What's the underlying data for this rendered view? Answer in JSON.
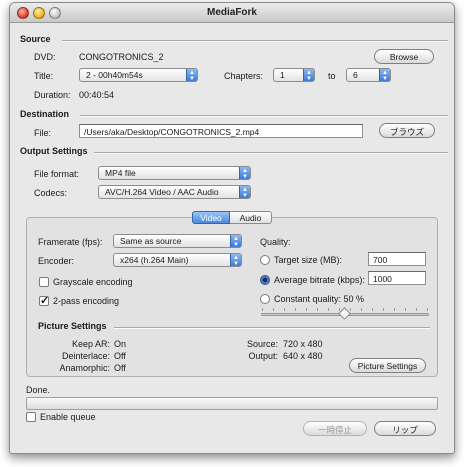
{
  "window": {
    "title": "MediaFork"
  },
  "source": {
    "section_label": "Source",
    "dvd_label": "DVD:",
    "dvd_value": "CONGOTRONICS_2",
    "browse_label": "Browse",
    "title_label": "Title:",
    "title_value": "2 - 00h40m54s",
    "chapters_label": "Chapters:",
    "chapter_from": "1",
    "to_label": "to",
    "chapter_to": "6",
    "duration_label": "Duration:",
    "duration_value": "00:40:54"
  },
  "destination": {
    "section_label": "Destination",
    "file_label": "File:",
    "file_value": "/Users/aka/Desktop/CONGOTRONICS_2.mp4",
    "browse_label": "ブラウズ"
  },
  "output": {
    "section_label": "Output Settings",
    "format_label": "File format:",
    "format_value": "MP4 file",
    "codecs_label": "Codecs:",
    "codecs_value": "AVC/H.264 Video / AAC Audio"
  },
  "tabs": {
    "video": "Video",
    "audio": "Audio",
    "selected": "Video"
  },
  "video": {
    "framerate_label": "Framerate (fps):",
    "framerate_value": "Same as source",
    "encoder_label": "Encoder:",
    "encoder_value": "x264 (h.264 Main)",
    "grayscale_label": "Grayscale encoding",
    "grayscale_checked": false,
    "twopass_label": "2-pass encoding",
    "twopass_checked": true,
    "quality_label": "Quality:",
    "target_size_label": "Target size (MB):",
    "target_size_value": "700",
    "avg_bitrate_label": "Average bitrate (kbps):",
    "avg_bitrate_value": "1000",
    "constant_quality_label": "Constant quality: 50 %",
    "quality_selected": "Average bitrate",
    "quality_slider_fraction": 0.5
  },
  "picture": {
    "section_label": "Picture Settings",
    "keep_ar_label": "Keep AR:",
    "keep_ar_value": "On",
    "deinterlace_label": "Deinterlace:",
    "deinterlace_value": "Off",
    "anamorphic_label": "Anamorphic:",
    "anamorphic_value": "Off",
    "source_label": "Source:",
    "source_value": "720 x 480",
    "output_label": "Output:",
    "output_value": "640 x 480",
    "settings_button": "Picture Settings"
  },
  "status": {
    "text": "Done.",
    "progress": 0
  },
  "queue": {
    "enable_label": "Enable queue",
    "checked": false
  },
  "actions": {
    "pause_label": "一時停止",
    "rip_label": "リップ"
  },
  "colors": {
    "accent": "#3a7bd8",
    "window_bg": "#e8e8e8"
  }
}
